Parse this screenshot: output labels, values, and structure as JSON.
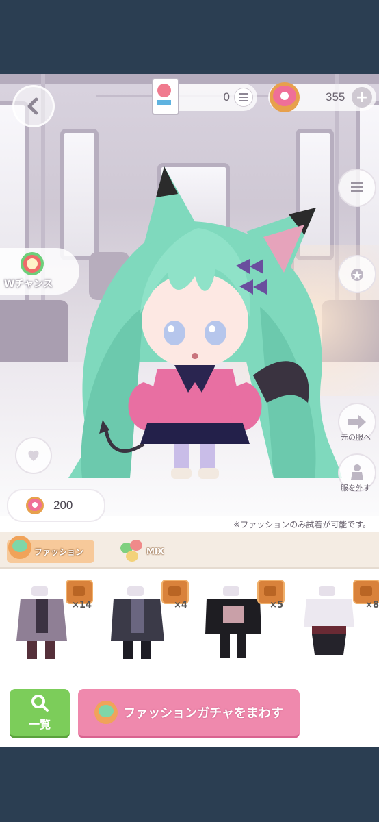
{
  "hud": {
    "ticket_count": "0",
    "donut_balance": "355"
  },
  "side": {
    "wchance_label": "Wチャンス",
    "restore_label": "元の服へ",
    "undress_label": "服を外す"
  },
  "donut_count": "200",
  "note": "※ファッションのみ試着が可能です。",
  "tabs": [
    {
      "label": "ファッション"
    },
    {
      "label": "MIX"
    }
  ],
  "items": [
    {
      "count": "×14"
    },
    {
      "count": "×4"
    },
    {
      "count": "×5"
    },
    {
      "count": "×8"
    }
  ],
  "buttons": {
    "list_label": "一覧",
    "gacha_label": "ファッションガチャをまわす"
  },
  "colors": {
    "accent_pink": "#ef89ad",
    "accent_green": "#7ccd5a",
    "hair": "#7fd9bd",
    "status_bar": "#2b3e52"
  }
}
